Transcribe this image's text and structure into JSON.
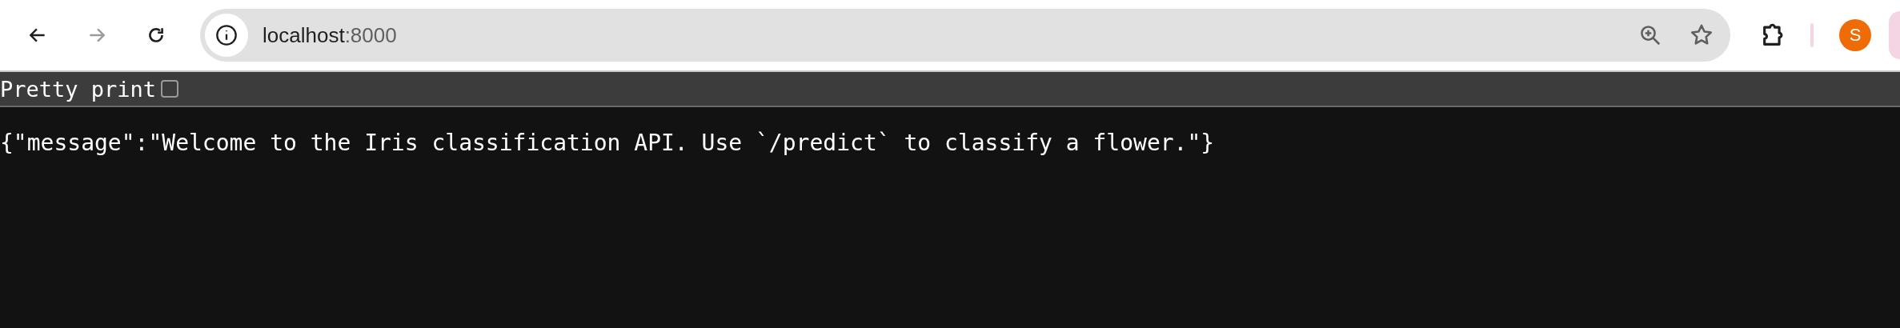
{
  "toolbar": {
    "back_disabled": false,
    "forward_disabled": true,
    "address": {
      "host": "localhost",
      "port": ":8000"
    },
    "profile_initial": "S"
  },
  "pretty_print": {
    "label": "Pretty print",
    "checked": false
  },
  "body": {
    "text": "{\"message\":\"Welcome to the Iris classification API. Use `/predict` to classify a flower.\"}"
  }
}
